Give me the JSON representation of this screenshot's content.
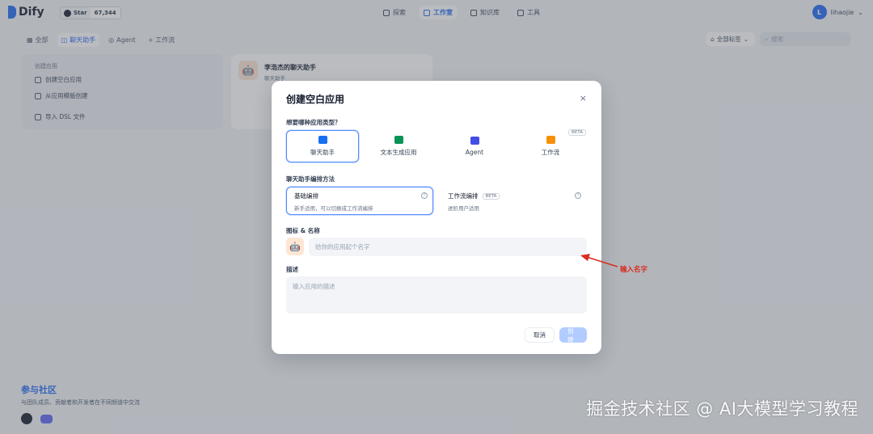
{
  "header": {
    "logo_text": "Dify",
    "github_star_label": "Star",
    "github_star_count": "67,344",
    "nav": [
      {
        "label": "探索",
        "icon": "compass-icon"
      },
      {
        "label": "工作室",
        "icon": "studio-icon"
      },
      {
        "label": "知识库",
        "icon": "book-icon"
      },
      {
        "label": "工具",
        "icon": "tool-icon"
      }
    ],
    "user_initial": "L",
    "user_name": "lihaojie"
  },
  "filters": {
    "tabs": [
      "全部",
      "聊天助手",
      "Agent",
      "工作流"
    ],
    "tag_filter": "全部标签",
    "search_placeholder": "搜索"
  },
  "create_card": {
    "title": "创建应用",
    "items": [
      "创建空白应用",
      "从应用模版创建",
      "导入 DSL 文件"
    ]
  },
  "app_card": {
    "name": "李浩杰的聊天助手",
    "type": "聊天助手",
    "emoji": "🤖"
  },
  "community": {
    "title": "参与社区",
    "desc": "与团队成员、贡献者和开发者在不同频道中交流"
  },
  "modal": {
    "title": "创建空白应用",
    "close": "×",
    "type_question": "想要哪种应用类型？",
    "types": [
      {
        "label": "聊天助手",
        "color": "#1570ef"
      },
      {
        "label": "文本生成应用",
        "color": "#079455"
      },
      {
        "label": "Agent",
        "color": "#444ce7"
      },
      {
        "label": "工作流",
        "color": "#f79009"
      }
    ],
    "beta": "BETA",
    "mode_label": "聊天助手编排方法",
    "modes": [
      {
        "title": "基础编排",
        "sub": "新手适用，可以切换成工作流编排"
      },
      {
        "title": "工作流编排",
        "sub": "进阶用户适用"
      }
    ],
    "name_label": "图标 & 名称",
    "name_placeholder": "给你的应用起个名字",
    "desc_label": "描述",
    "desc_placeholder": "输入应用的描述",
    "cancel": "取消",
    "create": "创建"
  },
  "annotation": {
    "text": "输入名字",
    "color": "#d92d20"
  },
  "watermark": "掘金技术社区 @ AI大模型学习教程"
}
